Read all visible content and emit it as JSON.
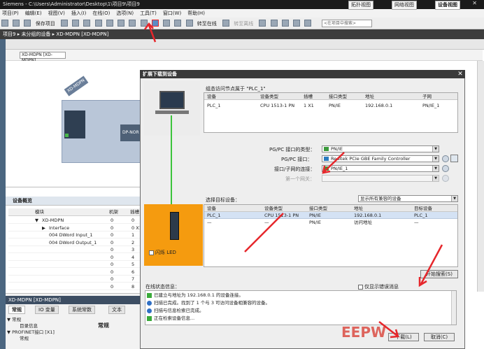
{
  "window": {
    "title": "Siemens  -  C:\\Users\\Administrator\\Desktop\\1\\项目9\\项目9",
    "controls": "_ □ ✕"
  },
  "menu": [
    "项目(P)",
    "编辑(E)",
    "视图(V)",
    "插入(I)",
    "在线(O)",
    "选项(N)",
    "工具(T)",
    "窗口(W)",
    "帮助(H)"
  ],
  "toolbar": {
    "save_label": "保存项目",
    "goonline_label": "转至在线",
    "gooffline_label": "转至离线",
    "search_placeholder": "<在项目中搜索>"
  },
  "breadcrumb": {
    "parts": [
      "项目9",
      "未分组的设备",
      "XD-MDPN [XD-MDPN]"
    ],
    "sep": " ▸ "
  },
  "view_tabs": [
    "拓扑视图",
    "网络视图",
    "设备视图"
  ],
  "device_selector": "XD-MDPN [XD-MDPN]",
  "canvas": {
    "device_label": "XD-MDPN",
    "dp_label": "DP-NOR"
  },
  "overview": {
    "title": "设备概览",
    "columns": [
      "模块",
      "机架",
      "插槽"
    ],
    "rows": [
      {
        "name": "XD-MDPN",
        "rack": "0",
        "slot": "0",
        "indent": 1,
        "expand": "▼"
      },
      {
        "name": "Interface",
        "rack": "0",
        "slot": "0 X1",
        "indent": 2,
        "expand": "▶"
      },
      {
        "name": "004 DWord Input_1",
        "rack": "0",
        "slot": "1",
        "indent": 2,
        "expand": ""
      },
      {
        "name": "004 DWord Output_1",
        "rack": "0",
        "slot": "2",
        "indent": 2,
        "expand": ""
      },
      {
        "name": "",
        "rack": "0",
        "slot": "3",
        "indent": 2,
        "expand": ""
      },
      {
        "name": "",
        "rack": "0",
        "slot": "4",
        "indent": 2,
        "expand": ""
      },
      {
        "name": "",
        "rack": "0",
        "slot": "5",
        "indent": 2,
        "expand": ""
      },
      {
        "name": "",
        "rack": "0",
        "slot": "6",
        "indent": 2,
        "expand": ""
      },
      {
        "name": "",
        "rack": "0",
        "slot": "7",
        "indent": 2,
        "expand": ""
      },
      {
        "name": "",
        "rack": "0",
        "slot": "8",
        "indent": 2,
        "expand": ""
      }
    ]
  },
  "properties": {
    "title": "XD-MDPN [XD-MDPN]",
    "tabs": [
      "常规",
      "IO 变量",
      "系统常数",
      "文本"
    ],
    "tree": [
      "▼ 常规",
      "目录信息",
      "▼ PROFINET接口 [X1]",
      "常规"
    ],
    "section_label": "常规"
  },
  "dialog": {
    "title": "扩展下载到设备",
    "configured_label": "组态访问节点属于 \"PLC_1\"",
    "cfg_columns": [
      "设备",
      "设备类型",
      "插槽",
      "接口类型",
      "地址",
      "子网"
    ],
    "cfg_row": [
      "PLC_1",
      "CPU 1513-1 PN",
      "1 X1",
      "PN/IE",
      "192.168.0.1",
      "PN/IE_1"
    ],
    "pgpc_type_label": "PG/PC 接口的类型：",
    "pgpc_type_value": "PN/IE",
    "pgpc_iface_label": "PG/PC 接口：",
    "pgpc_iface_value": "Realtek PCIe GBE Family Controller",
    "subnet_label": "接口/子网的连接：",
    "subnet_value": "PN/IE_1",
    "gateway_label": "第一个网关：",
    "target_label": "选择目标设备：",
    "filter_value": "显示所有兼容的设备",
    "tgt_columns": [
      "设备",
      "设备类型",
      "接口类型",
      "地址",
      "目标设备"
    ],
    "tgt_rows": [
      [
        "PLC_1",
        "CPU 1513-1 PN",
        "PN/IE",
        "192.168.0.1",
        "PLC_1"
      ],
      [
        "—",
        "—",
        "PN/IE",
        "访问地址",
        "—"
      ]
    ],
    "flash_led_label": "闪烁 LED",
    "start_search_label": "开始搜索(S)",
    "online_status_label": "在线状态信息：",
    "only_errors_label": "仅显示错误消息",
    "status_lines": [
      "已建立与地址为 192.168.0.1 的设备连接。",
      "扫描已完成。找到了 1 个与 3 可访问设备相兼容的设备。",
      "扫描与信息检索已完成。",
      "正在检索设备信息..."
    ],
    "download_label": "下载(L)",
    "cancel_label": "取消(C)"
  },
  "watermark": "EEPW",
  "colors": {
    "plc_panel": "#f59b0f",
    "link_line": "#3cc43c",
    "annotation_arrow": "#e6262b",
    "titlebar": "#1a1a1a"
  }
}
